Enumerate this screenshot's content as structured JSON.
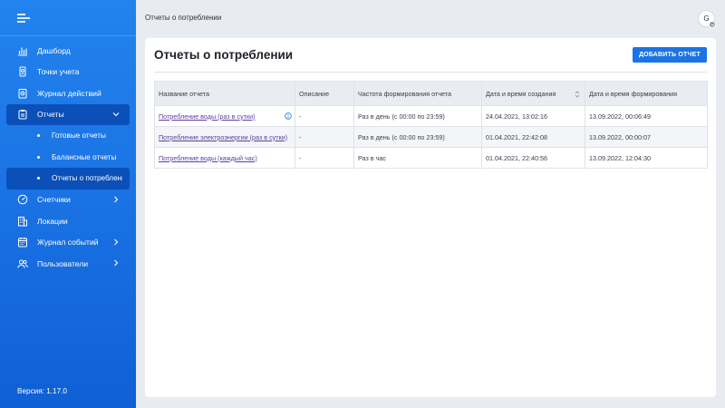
{
  "sidebar": {
    "items": [
      {
        "label": "Дашборд",
        "icon": "bar-chart-icon"
      },
      {
        "label": "Точки учета",
        "icon": "meter-point-icon"
      },
      {
        "label": "Журнал действий",
        "icon": "action-log-icon"
      },
      {
        "label": "Отчеты",
        "icon": "reports-icon",
        "expanded": true,
        "children": [
          {
            "label": "Готовые отчеты"
          },
          {
            "label": "Балансные отчеты"
          },
          {
            "label": "Отчеты о потреблении",
            "active": true
          }
        ]
      },
      {
        "label": "Счетчики",
        "icon": "gauge-icon"
      },
      {
        "label": "Локации",
        "icon": "building-icon"
      },
      {
        "label": "Журнал событий",
        "icon": "calendar-icon"
      },
      {
        "label": "Пользователи",
        "icon": "users-icon"
      }
    ],
    "version": "Версия: 1.17.0"
  },
  "topbar": {
    "breadcrumb": "Отчеты о потреблении",
    "avatar_letter": "G"
  },
  "main": {
    "title": "Отчеты о потреблении",
    "add_button": "ДОБАВИТЬ ОТЧЕТ",
    "table": {
      "headers": [
        "Название отчета",
        "Описание",
        "Частота формирования отчета",
        "Дата и время создания",
        "Дата и время формирования"
      ],
      "rows": [
        [
          "Потребление воды (раз в сутки)",
          "-",
          "Раз в день (с 00:00 по 23:59)",
          "24.04.2021, 13:02:16",
          "13.09.2022, 00:06:49"
        ],
        [
          "Потребление электроэнергии (раз в сутки)",
          "-",
          "Раз в день (с 00:00 по 23:59)",
          "01.04.2021, 22:42:08",
          "13.09.2022, 00:00:07"
        ],
        [
          "Потребление воды (каждый час)",
          "-",
          "Раз в час",
          "01.04.2021, 22:40:56",
          "13.09.2022, 12:04:30"
        ]
      ]
    }
  },
  "colors": {
    "sidebar_top": "#2283ee",
    "sidebar_bottom": "#0f5fd6",
    "active_item": "#0b50b8",
    "accent": "#1b74e4",
    "link": "#5b3ea0"
  }
}
